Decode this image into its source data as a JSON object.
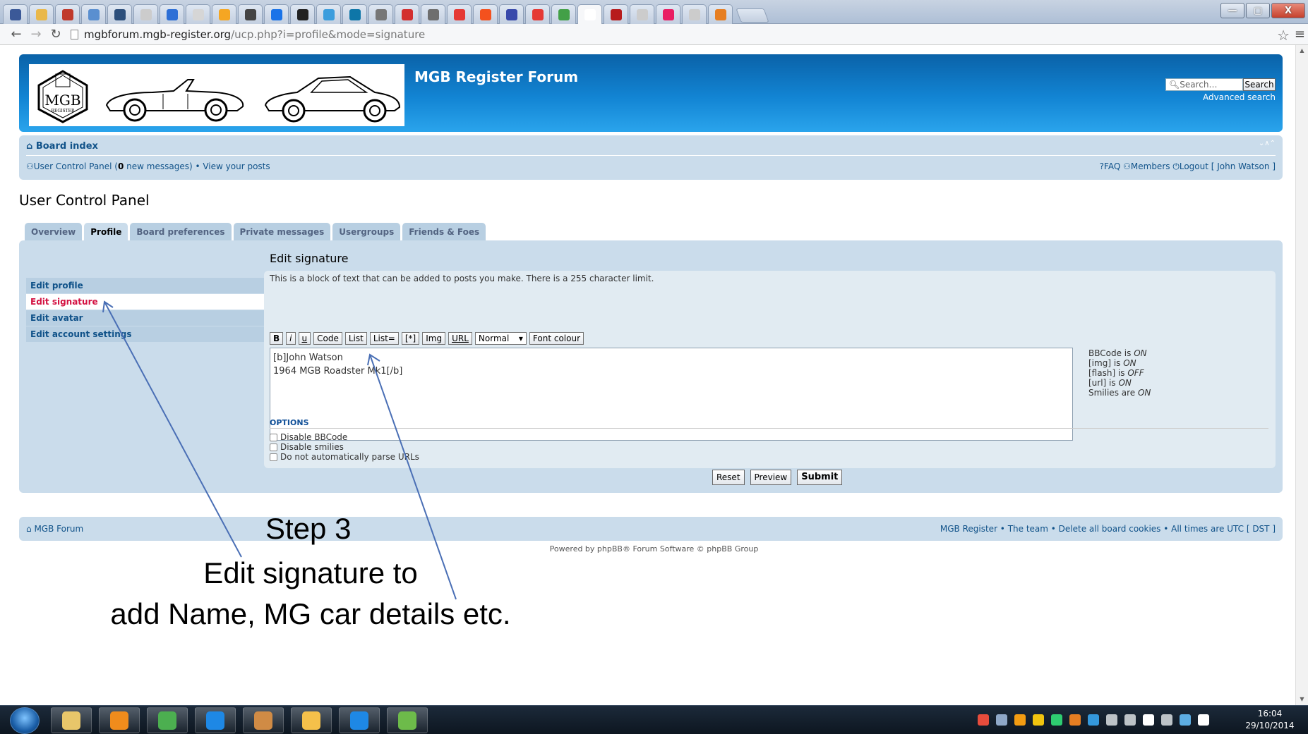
{
  "browser": {
    "tab_colors": [
      "#3b5998",
      "#e9b84b",
      "#c0392b",
      "#5a8fd0",
      "#2c4f7c",
      "#cccccc",
      "#2d6fd6",
      "#d6d6d6",
      "#f5a623",
      "#444444",
      "#1a73e8",
      "#222222",
      "#3b9ddd",
      "#0e76a8",
      "#777777",
      "#d32f2f",
      "#6e6e6e",
      "#e53935",
      "#f4511e",
      "#3949ab",
      "#e53935",
      "#43a047",
      "#ffffff",
      "#b71c1c",
      "#cccccc",
      "#e91e63",
      "#cccccc",
      "#e67e22"
    ],
    "url_host": "mgbforum.mgb-register.org",
    "url_path": "/ucp.php?i=profile&mode=signature",
    "back_icon": "arrow-left-icon",
    "forward_icon": "arrow-right-icon",
    "reload_icon": "reload-icon",
    "minimize": "—",
    "maximize": "▢",
    "close": "X"
  },
  "header": {
    "logo_badge": "MGB",
    "logo_badge_sub": "REGISTER",
    "site_title": "MGB Register Forum",
    "search_placeholder": "Search…",
    "search_button": "Search",
    "advanced_search": "Advanced search"
  },
  "navbar": {
    "board_index": "Board index",
    "ucp_link": "User Control Panel (",
    "new_messages_count": "0",
    "new_messages_suffix": " new messages) • View your posts",
    "faq": "FAQ",
    "members": "Members",
    "logout": "Logout [ John Watson ]"
  },
  "page_title": "User Control Panel",
  "ucp_tabs": [
    "Overview",
    "Profile",
    "Board preferences",
    "Private messages",
    "Usergroups",
    "Friends & Foes"
  ],
  "side_menu": [
    "Edit profile",
    "Edit signature",
    "Edit avatar",
    "Edit account settings"
  ],
  "editor": {
    "title": "Edit signature",
    "description": "This is a block of text that can be added to posts you make. There is a 255 character limit.",
    "toolbar": [
      "B",
      "i",
      "u",
      "Code",
      "List",
      "List=",
      "[*]",
      "Img",
      "URL"
    ],
    "font_size_value": "Normal",
    "font_colour": "Font colour",
    "signature_text": "[b]John Watson\n1964 MGB Roadster Mk1[/b]",
    "bbcode_info": [
      {
        "label": "BBCode is ",
        "state": "ON"
      },
      {
        "label": "[img] is ",
        "state": "ON"
      },
      {
        "label": "[flash] is ",
        "state": "OFF"
      },
      {
        "label": "[url] is ",
        "state": "ON"
      },
      {
        "label": "Smilies are ",
        "state": "ON"
      }
    ],
    "options_title": "OPTIONS",
    "options": [
      "Disable BBCode",
      "Disable smilies",
      "Do not automatically parse URLs"
    ],
    "reset": "Reset",
    "preview": "Preview",
    "submit": "Submit"
  },
  "footer": {
    "left": "MGB Forum",
    "right": "MGB Register • The team • Delete all board cookies • All times are UTC [ DST ]",
    "powered": "Powered by phpBB® Forum Software © phpBB Group"
  },
  "annotation": {
    "step": "Step 3",
    "line1": "Edit signature to",
    "line2": "add Name, MG car details etc."
  },
  "taskbar": {
    "apps": [
      "folder",
      "media",
      "chrome",
      "internet-explorer",
      "paint",
      "outlook",
      "dropbox",
      "maps"
    ],
    "app_colors": [
      "#e8c66a",
      "#f08c1c",
      "#4caf50",
      "#1e88e5",
      "#d08b45",
      "#f5c04a",
      "#1e88e5",
      "#6dbb4a"
    ],
    "tray_colors": [
      "#e74c3c",
      "#8fa8c8",
      "#f39c12",
      "#f1c40f",
      "#2ecc71",
      "#e67e22",
      "#3498db",
      "#bdc3c7",
      "#bdc3c7",
      "#ffffff",
      "#bdc3c7",
      "#5dade2",
      "#ffffff"
    ],
    "time": "16:04",
    "date": "29/10/2014"
  }
}
